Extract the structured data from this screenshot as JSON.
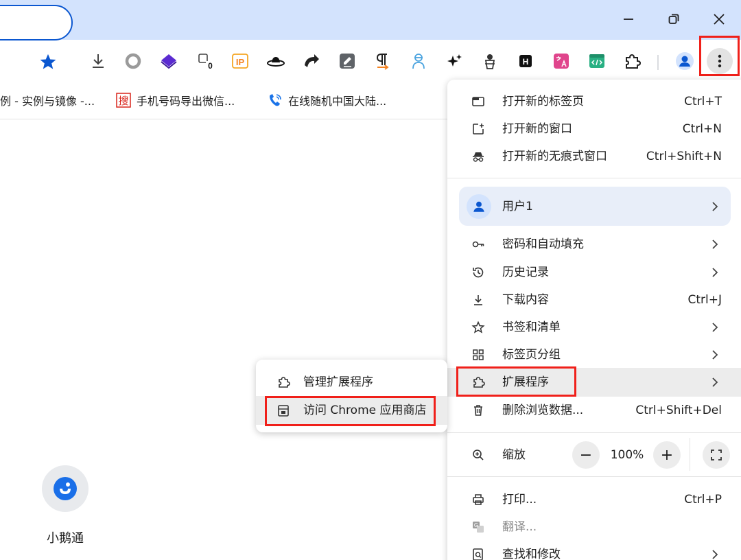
{
  "colors": {
    "titlebar": "#d3e3fd",
    "accent": "#0b57d0",
    "highlight_box": "#f0201a"
  },
  "window_controls": [
    "minimize-icon",
    "restore-icon",
    "close-icon"
  ],
  "toolbar": {
    "bookmark_star_icon": "star-icon",
    "extension_icons": [
      "download-icon",
      "circle-icon",
      "layers-icon",
      "counter-icon",
      "ip-icon",
      "hat-icon",
      "arrow-icon",
      "edit-icon",
      "pilcrow-icon",
      "figure-icon",
      "sparkle-icon",
      "ghost-icon",
      "h-icon",
      "translate-icon",
      "code-icon",
      "puzzle-icon",
      "profile-icon",
      "more-icon"
    ],
    "ip_label": "IP",
    "h_label": "H",
    "badge": "0"
  },
  "bookmarks": [
    {
      "label": "例 - 实例与镜像 -...",
      "icon": "none"
    },
    {
      "label": "手机号码导出微信...",
      "icon": "sou-favicon",
      "favicon_text": "搜"
    },
    {
      "label": "在线随机中国大陆...",
      "icon": "phone-favicon"
    }
  ],
  "shortcut": {
    "label": "小鹅通",
    "icon": "xiaoetong-icon"
  },
  "menu": {
    "new_tab": {
      "label": "打开新的标签页",
      "shortcut": "Ctrl+T"
    },
    "new_window": {
      "label": "打开新的窗口",
      "shortcut": "Ctrl+N"
    },
    "incognito": {
      "label": "打开新的无痕式窗口",
      "shortcut": "Ctrl+Shift+N"
    },
    "profile": {
      "label": "用户1"
    },
    "passwords": {
      "label": "密码和自动填充"
    },
    "history": {
      "label": "历史记录"
    },
    "downloads": {
      "label": "下载内容",
      "shortcut": "Ctrl+J"
    },
    "bookmarks": {
      "label": "书签和清单"
    },
    "tab_groups": {
      "label": "标签页分组"
    },
    "extensions": {
      "label": "扩展程序"
    },
    "clear_data": {
      "label": "删除浏览数据...",
      "shortcut": "Ctrl+Shift+Del"
    },
    "zoom": {
      "label": "缩放",
      "minus": "−",
      "value": "100%",
      "plus": "+"
    },
    "print": {
      "label": "打印...",
      "shortcut": "Ctrl+P"
    },
    "translate": {
      "label": "翻译..."
    },
    "find": {
      "label": "查找和修改"
    }
  },
  "submenu": {
    "manage": {
      "label": "管理扩展程序"
    },
    "store": {
      "label": "访问 Chrome 应用商店"
    }
  }
}
